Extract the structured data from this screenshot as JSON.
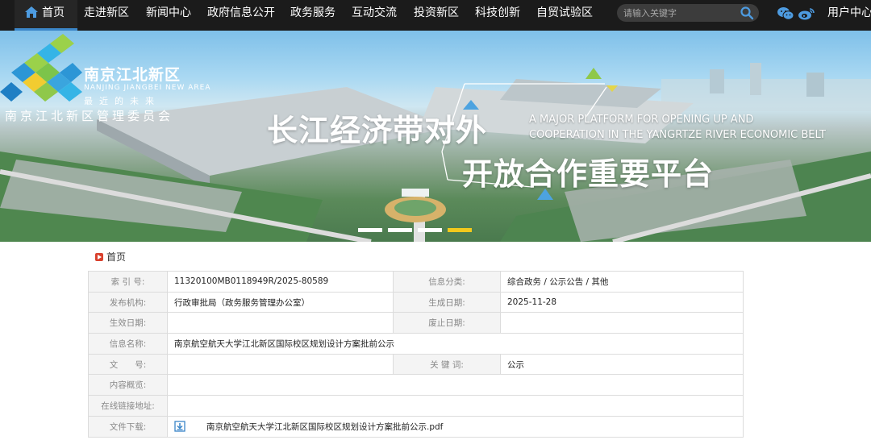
{
  "nav": {
    "items": [
      "首页",
      "走进新区",
      "新闻中心",
      "政府信息公开",
      "政务服务",
      "互动交流",
      "投资新区",
      "科技创新",
      "自贸试验区"
    ],
    "search_placeholder": "请输入关键字",
    "user_center": "用户中心",
    "social_icons": [
      "wechat-icon",
      "weibo-icon"
    ],
    "accent_color": "#3b86c8"
  },
  "banner": {
    "logo_cn": "南京江北新区",
    "logo_en": "NANJING JIANGBEI NEW AREA",
    "logo_slogan": "最近的未来",
    "logo_org": "南京江北新区管理委员会",
    "headline_1": "长江经济带对外",
    "headline_2": "开放合作重要平台",
    "sub_1": "A MAJOR PLATFORM FOR OPENING UP AND",
    "sub_2": "COOPERATION IN THE YANGRTZE RIVER ECONOMIC BELT",
    "slide_count": 4,
    "active_slide": 4,
    "dot_color_active": "#f2c91c"
  },
  "breadcrumb": {
    "home": "首页"
  },
  "info": {
    "rows": [
      {
        "l1": "索 引 号:",
        "v1": "11320100MB0118949R/2025-80589",
        "l2": "信息分类:",
        "v2": "综合政务 / 公示公告 / 其他"
      },
      {
        "l1": "发布机构:",
        "v1": "行政审批局（政务服务管理办公室）",
        "l2": "生成日期:",
        "v2": "2025-11-28"
      },
      {
        "l1": "生效日期:",
        "v1": "",
        "l2": "废止日期:",
        "v2": ""
      }
    ],
    "name_label": "信息名称:",
    "name_value": "南京航空航天大学江北新区国际校区规划设计方案批前公示",
    "doc_label": "文　　号:",
    "doc_value": "",
    "keyword_label": "关 键 词:",
    "keyword_value": "公示",
    "summary_label": "内容概览:",
    "summary_value": "",
    "link_label": "在线链接地址:",
    "link_value": "",
    "download_label": "文件下载:",
    "download_file": "南京航空航天大学江北新区国际校区规划设计方案批前公示.pdf"
  }
}
